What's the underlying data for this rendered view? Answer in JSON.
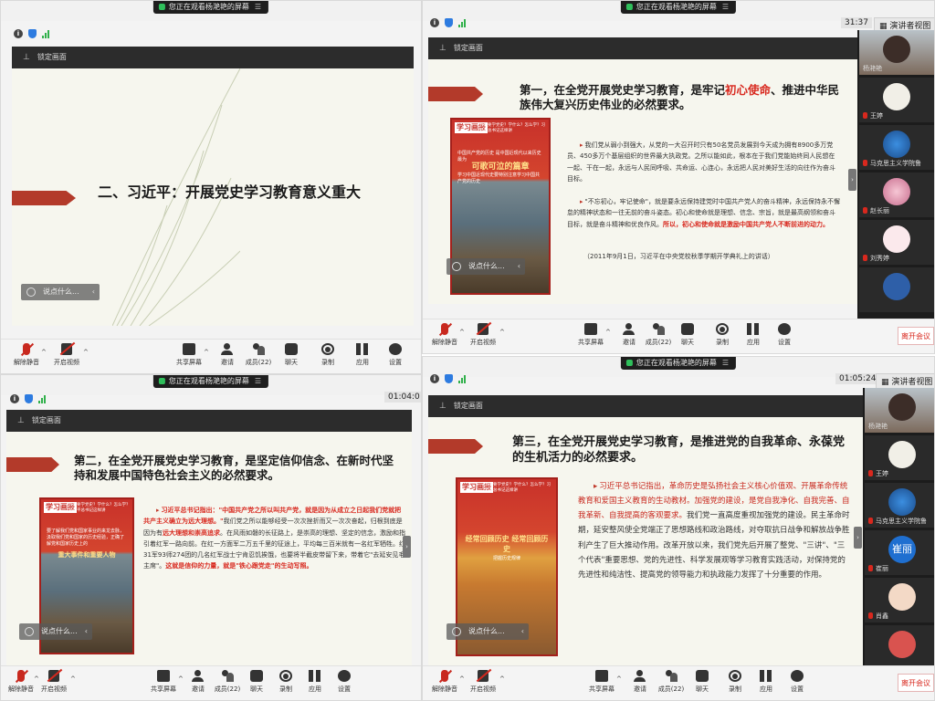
{
  "watch_banner": "您正在观看杨滟艳的屏幕",
  "lock_label": "锁定画面",
  "chat_placeholder": "说点什么...",
  "toolbar": {
    "unmute": "解除静音",
    "video": "开启视频",
    "share": "共享屏幕",
    "invite": "邀请",
    "members": "成员(22)",
    "chat": "聊天",
    "record": "录制",
    "apps": "应用",
    "settings": "设置",
    "leave": "离开会议"
  },
  "presenter_view": "演讲者视图",
  "timers": {
    "p2": "31:37",
    "p3": "01:04:0",
    "p4": "01:05:24"
  },
  "participants": {
    "p2": [
      "杨滟艳",
      "王婷",
      "马克思主义学院鲁",
      "赵长丽",
      "刘秀婷"
    ],
    "p4": [
      "杨滟艳",
      "王婷",
      "马克思主义学院鲁",
      "崔丽",
      "肖鑫"
    ]
  },
  "slide1": {
    "title": "二、习近平：开展党史学习教育意义重大"
  },
  "slide2": {
    "title_a": "第一，在全党开展党史学习教育，是牢记",
    "title_red": "初心使命",
    "title_b": "、推进中华民族伟大复兴历史伟业的必然要求。",
    "para1": "我们党从弱小到强大，从党的一大召开时只有50名党员发展到今天成为拥有8900多万党员、450多万个基层组织的世界最大执政党。之所以能如此，根本在于我们党能始终同人民想在一起、干在一起，永远与人民同呼吸、共命运、心连心，永远把人民对美好生活的向往作为奋斗目标。",
    "para2a": "\"不忘初心，牢记使命\"，就是要永远保持建党时中国共产党人的奋斗精神，永远保持永不懈怠的精神状态和一往无前的奋斗姿态。初心和使命就是理想、信念、宗旨，就是最高纲领和奋斗目标，就是奋斗精神和优良作风。",
    "para2_red": "所以，初心和使命就是激励中国共产党人不断前进的动力。",
    "citation": "（2011年9月1日，习近平在中央党校秋季学期开学典礼上的讲话）",
    "cover_brand": "学习画报",
    "cover_tagline": "为何要学党史？学什么？怎么学？习近平总书记这样讲",
    "cover_sub": "中国共产党的历史 是中国近现代以来历史最为",
    "cover_headline": "可歌可泣的篇章",
    "cover_sub2": "学习中国近现代史要特别注意学习中国共产党的历史"
  },
  "slide3": {
    "title": "第二，在全党开展党史学习教育，是坚定信仰信念、在新时代坚持和发展中国特色社会主义的必然要求。",
    "lead_red": "习近平总书记指出：\"中国共产党之所以叫共产党，就是因为从成立之日起我们党就把共产主义确立为远大理想。\"",
    "lead": "我们党之所以能够经受一次次挫折而又一次次奋起，归根到底是因为有",
    "lead_red2": "远大理想和崇高追求",
    "body": "。在风雨如磐的长征路上，是崇高的理想、坚定的信念，激励和指引着红军一路向前。在红一方面军二万五千里的征途上，平均每三百米就有一名红军牺牲。红31军93师274团的几名红军战士宁肯忍饥挨饿，也要将半截皮带留下来，带着它\"去延安见毛主席\"。",
    "tail_red": "这就是信仰的力量，就是\"铁心跟党走\"的生动写照。",
    "cover_brand": "学习画报",
    "cover_tagline": "为何要学党史？学什么？怎么学？习近平总书记这样讲",
    "cover_headline": "重大事件和重要人物",
    "cover_sub": "要了解我们党和国家事业的来龙去脉，汲取我们党和国家的历史经验，正确了解党和国家历史上的"
  },
  "slide4": {
    "title": "第三，在全党开展党史学习教育，是推进党的自我革命、永葆党的生机活力的必然要求。",
    "lead_red": "习近平总书记指出，革命历史是弘扬社会主义核心价值观、开展革命传统教育和爱国主义教育的生动教材。加强党的建设，是党自我净化、自我完善、自我革新、自我提高的客观要求。",
    "body": "我们党一直高度重视加强党的建设。民主革命时期，延安整风使全党端正了思想路线和政治路线，对夺取抗日战争和解放战争胜利产生了巨大推动作用。改革开放以来，我们党先后开展了整党、\"三讲\"、\"三个代表\"重要思想、党的先进性、科学发展观等学习教育实践活动，对保持党的先进性和纯洁性、提高党的领导能力和执政能力发挥了十分重要的作用。",
    "cover_brand": "学习画报",
    "cover_tagline": "为何要学党史？学什么？怎么学？习近平总书记这样讲",
    "cover_headline": "经常回顾历史 经常回顾历史",
    "cover_sub": "把握历史规律"
  },
  "colors": {
    "accent_red": "#d8281e",
    "tag_red": "#b33a2a",
    "slide_bg": "#f6f6ee"
  }
}
